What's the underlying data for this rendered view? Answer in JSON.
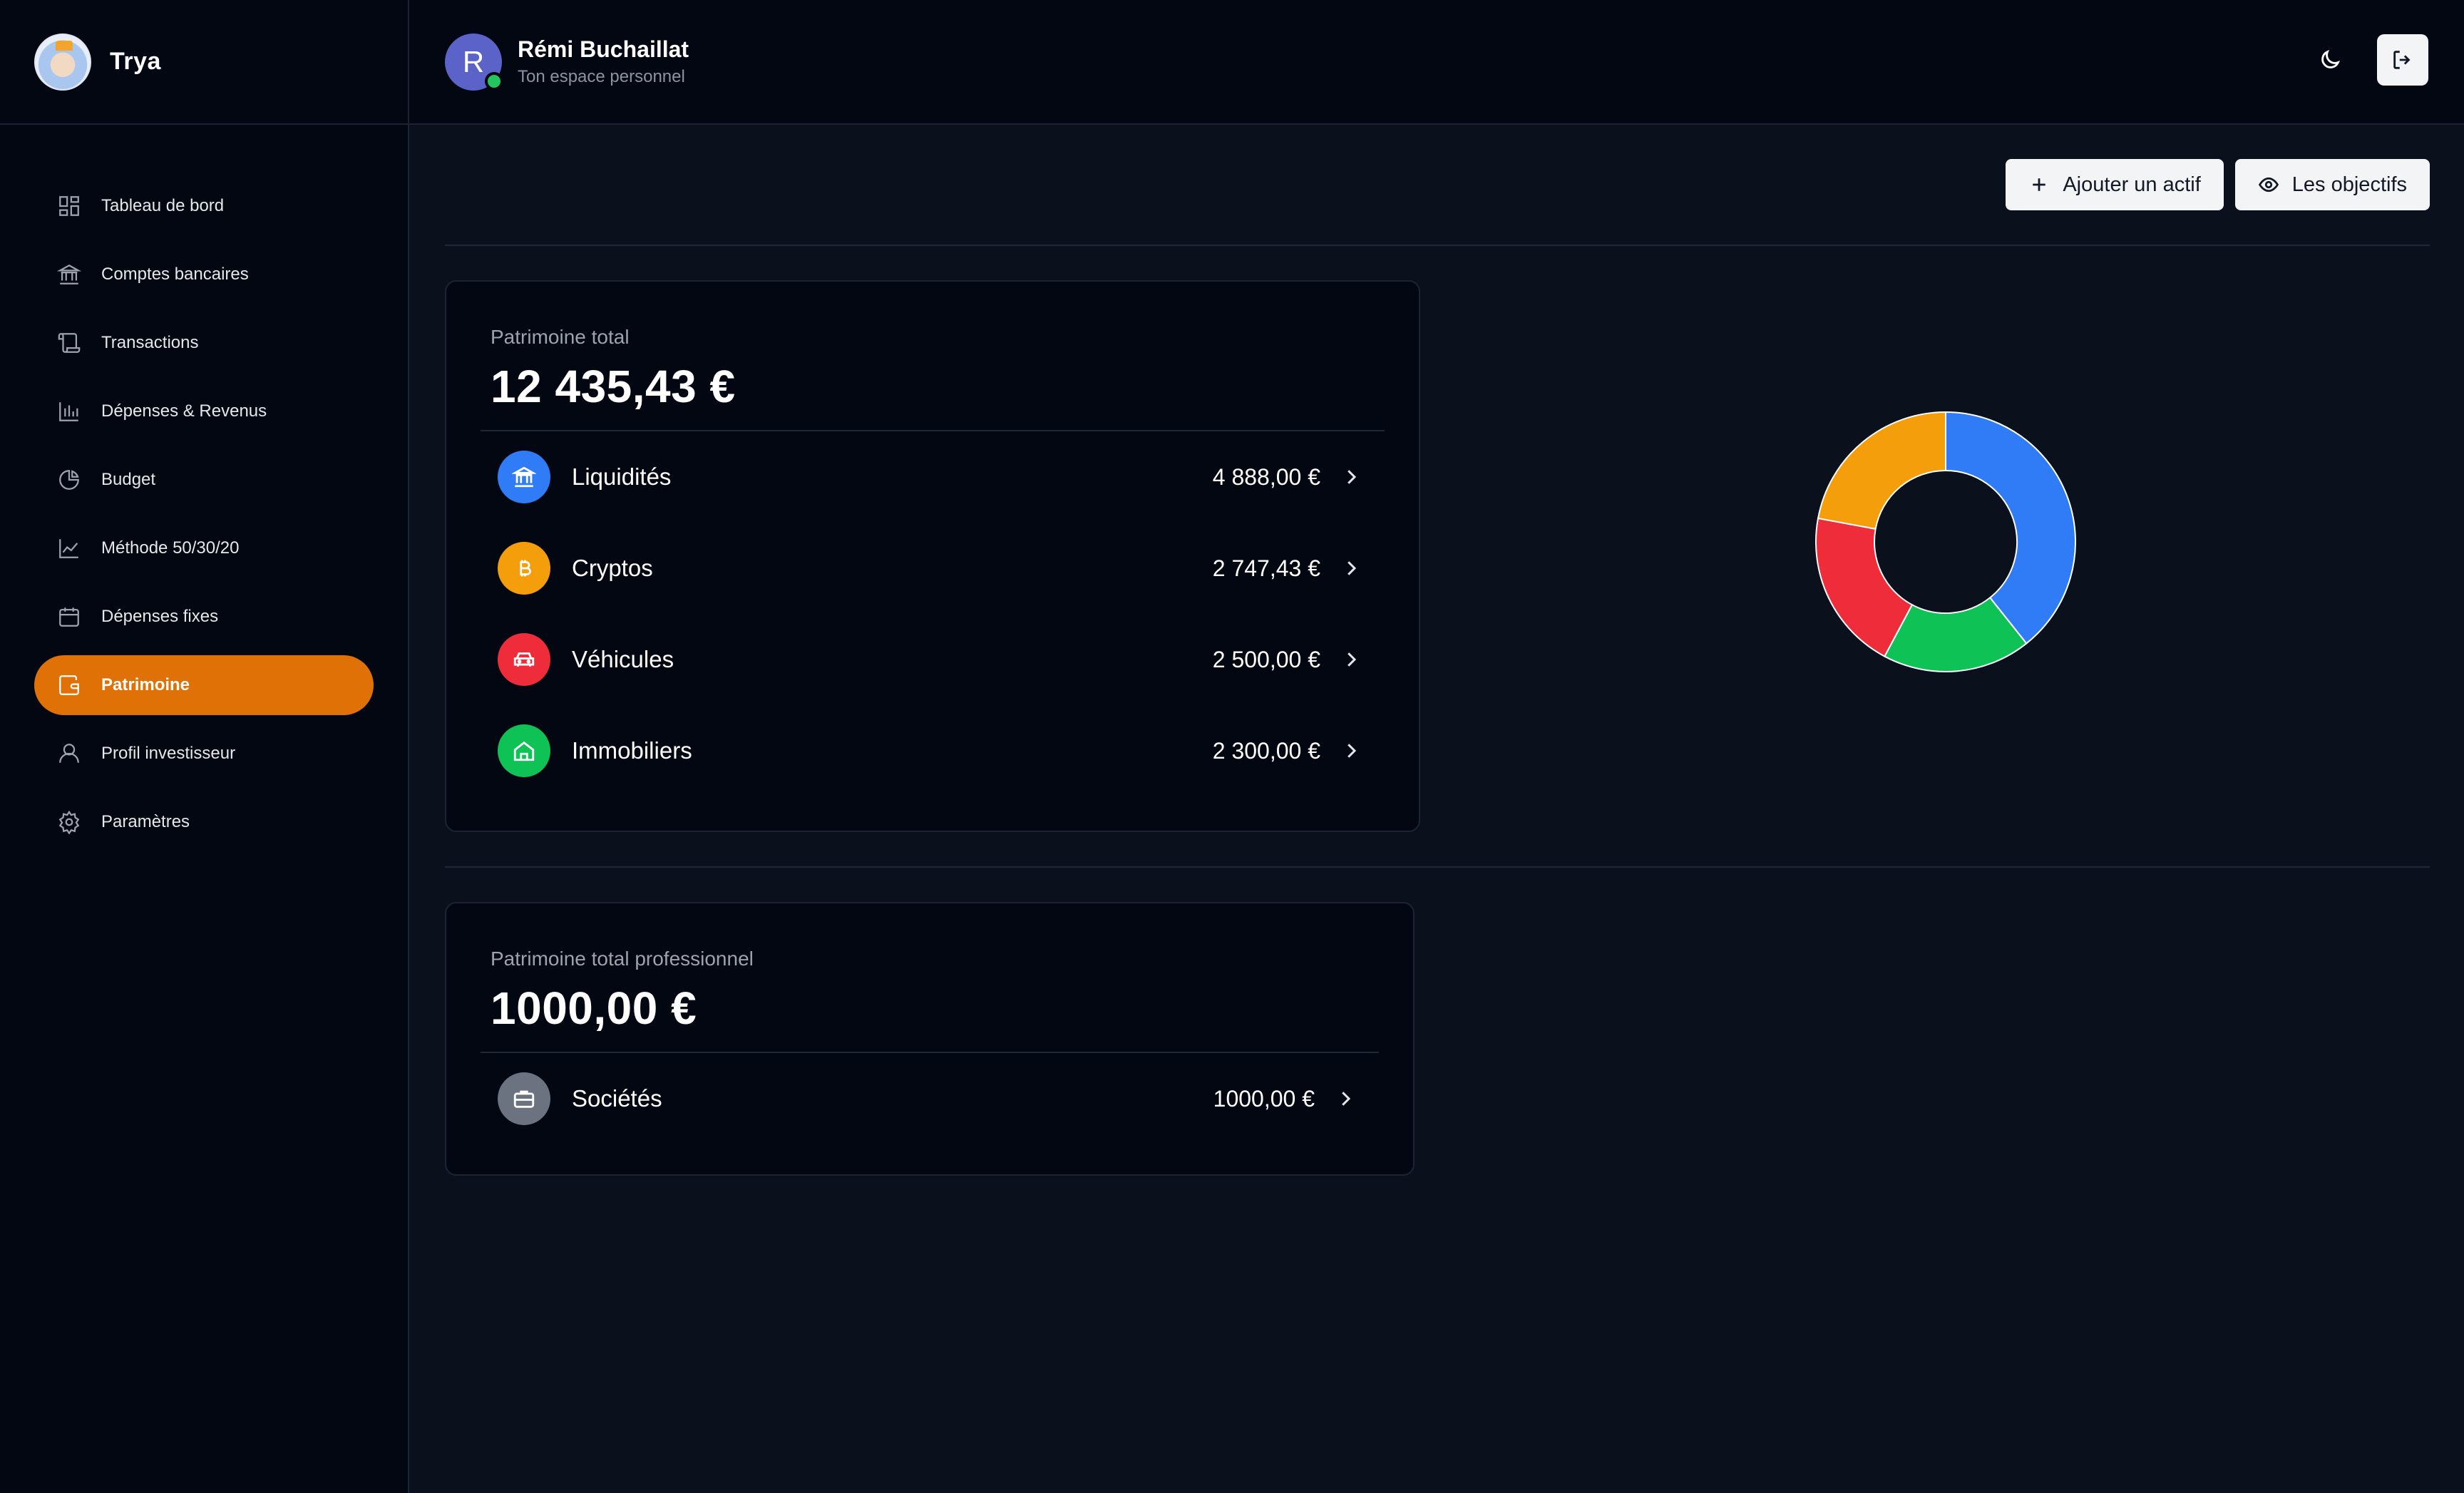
{
  "app": {
    "name": "Trya"
  },
  "sidebar": {
    "items": [
      {
        "label": "Tableau de bord",
        "icon": "dashboard-icon",
        "active": false
      },
      {
        "label": "Comptes bancaires",
        "icon": "bank-icon",
        "active": false
      },
      {
        "label": "Transactions",
        "icon": "scroll-icon",
        "active": false
      },
      {
        "label": "Dépenses & Revenus",
        "icon": "bar-chart-icon",
        "active": false
      },
      {
        "label": "Budget",
        "icon": "pie-icon",
        "active": false
      },
      {
        "label": "Méthode 50/30/20",
        "icon": "line-chart-icon",
        "active": false
      },
      {
        "label": "Dépenses fixes",
        "icon": "calendar-icon",
        "active": false
      },
      {
        "label": "Patrimoine",
        "icon": "wallet-icon",
        "active": true
      },
      {
        "label": "Profil investisseur",
        "icon": "user-icon",
        "active": false
      },
      {
        "label": "Paramètres",
        "icon": "gear-icon",
        "active": false
      }
    ]
  },
  "header": {
    "avatar_initial": "R",
    "user_name": "Rémi Buchaillat",
    "subtitle": "Ton espace personnel"
  },
  "toolbar": {
    "add_asset_label": "Ajouter un actif",
    "goals_label": "Les objectifs"
  },
  "personal": {
    "label": "Patrimoine total",
    "total": "12 435,43 €",
    "assets": [
      {
        "name": "Liquidités",
        "value": "4 888,00 €",
        "icon": "bank-icon",
        "color": "#2f7cf6"
      },
      {
        "name": "Cryptos",
        "value": "2 747,43 €",
        "icon": "bitcoin-icon",
        "color": "#f59e0b"
      },
      {
        "name": "Véhicules",
        "value": "2 500,00 €",
        "icon": "car-icon",
        "color": "#ef2d3a"
      },
      {
        "name": "Immobiliers",
        "value": "2 300,00 €",
        "icon": "house-icon",
        "color": "#0ec256"
      }
    ]
  },
  "professional": {
    "label": "Patrimoine total professionnel",
    "total": "1000,00 €",
    "assets": [
      {
        "name": "Sociétés",
        "value": "1000,00 €",
        "icon": "briefcase-icon",
        "color": "#6b7280"
      }
    ]
  },
  "chart_data": {
    "type": "pie",
    "donut": true,
    "categories": [
      "Liquidités",
      "Cryptos",
      "Véhicules",
      "Immobiliers"
    ],
    "values": [
      4888.0,
      2747.43,
      2500.0,
      2300.0
    ],
    "colors": [
      "#2f7cf6",
      "#f59e0b",
      "#ef2d3a",
      "#0ec256"
    ],
    "order_clockwise_from_top": [
      "Liquidités",
      "Immobiliers",
      "Véhicules",
      "Cryptos"
    ],
    "legend": "none"
  }
}
